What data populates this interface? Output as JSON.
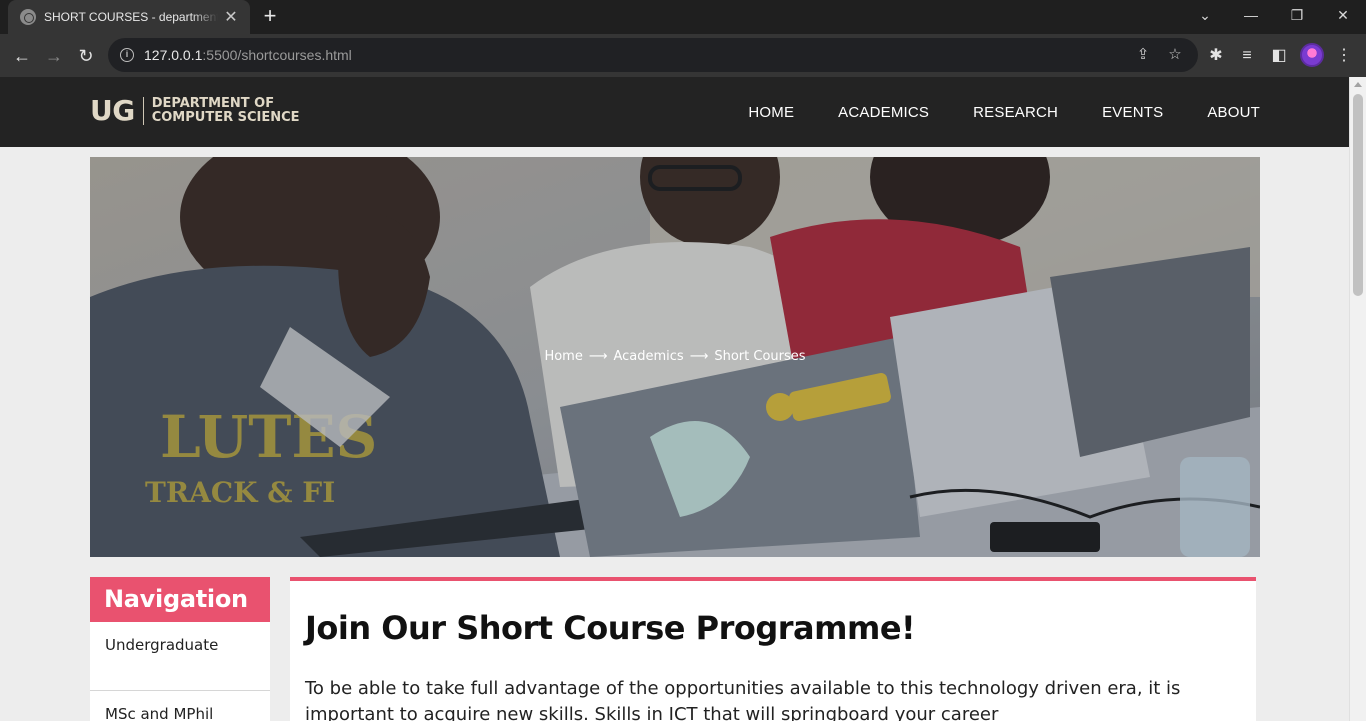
{
  "browser": {
    "tab_title": "SHORT COURSES - department of computer science",
    "url_host": "127.0.0.1",
    "url_rest": ":5500/shortcourses.html"
  },
  "site": {
    "logo_mark": "UG",
    "logo_line1": "DEPARTMENT OF",
    "logo_line2": "COMPUTER SCIENCE",
    "nav": [
      "HOME",
      "ACADEMICS",
      "RESEARCH",
      "EVENTS",
      "ABOUT"
    ]
  },
  "hero": {
    "breadcrumb": [
      "Home",
      "Academics",
      "Short Courses"
    ],
    "arrow": "⟶"
  },
  "sidebar": {
    "heading": "Navigation",
    "items": [
      "Undergraduate",
      "MSc and MPhil"
    ]
  },
  "content": {
    "heading": "Join Our Short Course Programme!",
    "paragraph": "To be able to take full advantage of the opportunities available to this technology driven era, it is important to acquire new skills. Skills in ICT that will springboard your career"
  },
  "colors": {
    "accent": "#e9526f",
    "header_bg": "#232323",
    "page_bg": "#ededed"
  }
}
